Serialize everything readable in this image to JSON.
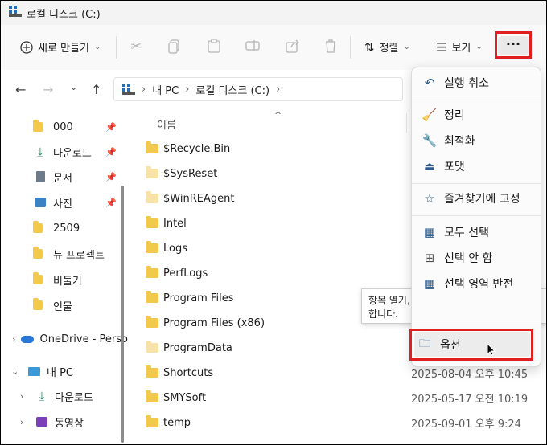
{
  "window": {
    "title": "로컬 디스크 (C:)"
  },
  "toolbar": {
    "new_label": "새로 만들기",
    "sort_label": "정렬",
    "view_label": "보기",
    "more_label": "···"
  },
  "address": {
    "root": "내 PC",
    "current": "로컬 디스크 (C:)"
  },
  "columns": {
    "name": "이름"
  },
  "sidebar": {
    "quick": [
      {
        "label": "000",
        "icon": "folder-icon",
        "pinned": true
      },
      {
        "label": "다운로드",
        "icon": "download-icon",
        "pinned": true
      },
      {
        "label": "문서",
        "icon": "document-icon",
        "pinned": true
      },
      {
        "label": "사진",
        "icon": "picture-icon",
        "pinned": true
      },
      {
        "label": "2509",
        "icon": "folder-icon",
        "pinned": false
      },
      {
        "label": "뉴 프로젝트",
        "icon": "folder-icon",
        "pinned": false
      },
      {
        "label": "비둘기",
        "icon": "folder-icon",
        "pinned": false
      },
      {
        "label": "인물",
        "icon": "folder-icon",
        "pinned": false
      }
    ],
    "onedrive": "OneDrive - Perso",
    "thispc": "내 PC",
    "pc_children": [
      {
        "label": "다운로드",
        "icon": "download-icon"
      },
      {
        "label": "동영상",
        "icon": "video-icon"
      }
    ]
  },
  "files": [
    {
      "name": "$Recycle.Bin",
      "light": false,
      "date": ""
    },
    {
      "name": "$SysReset",
      "light": true,
      "date": ""
    },
    {
      "name": "$WinREAgent",
      "light": true,
      "date": ""
    },
    {
      "name": "Intel",
      "light": false,
      "date": ""
    },
    {
      "name": "Logs",
      "light": false,
      "date": ""
    },
    {
      "name": "PerfLogs",
      "light": false,
      "date": ""
    },
    {
      "name": "Program Files",
      "light": false,
      "date": ""
    },
    {
      "name": "Program Files (x86)",
      "light": false,
      "date": ""
    },
    {
      "name": "ProgramData",
      "light": true,
      "date": ""
    },
    {
      "name": "Shortcuts",
      "light": false,
      "date": "2025-08-04 오후 10:45"
    },
    {
      "name": "SMYSoft",
      "light": false,
      "date": "2025-05-17 오전 10:19"
    },
    {
      "name": "temp",
      "light": false,
      "date": "2025-09-01 오후 9:24"
    }
  ],
  "menu": {
    "undo": "실행 취소",
    "cleanup": "정리",
    "optimize": "최적화",
    "format": "포맷",
    "pin_quick": "즐겨찾기에 고정",
    "select_all": "모두 선택",
    "select_none": "선택 안 함",
    "invert": "선택 영역 반전",
    "options": "옵션"
  },
  "tooltip": {
    "line1": "항목 열기, 파일 및 폴더 보기, 검색에 대한",
    "line2": "합니다."
  },
  "colors": {
    "highlight": "#e02020",
    "folder": "#f2c94c",
    "accent": "#2b5a8a"
  }
}
